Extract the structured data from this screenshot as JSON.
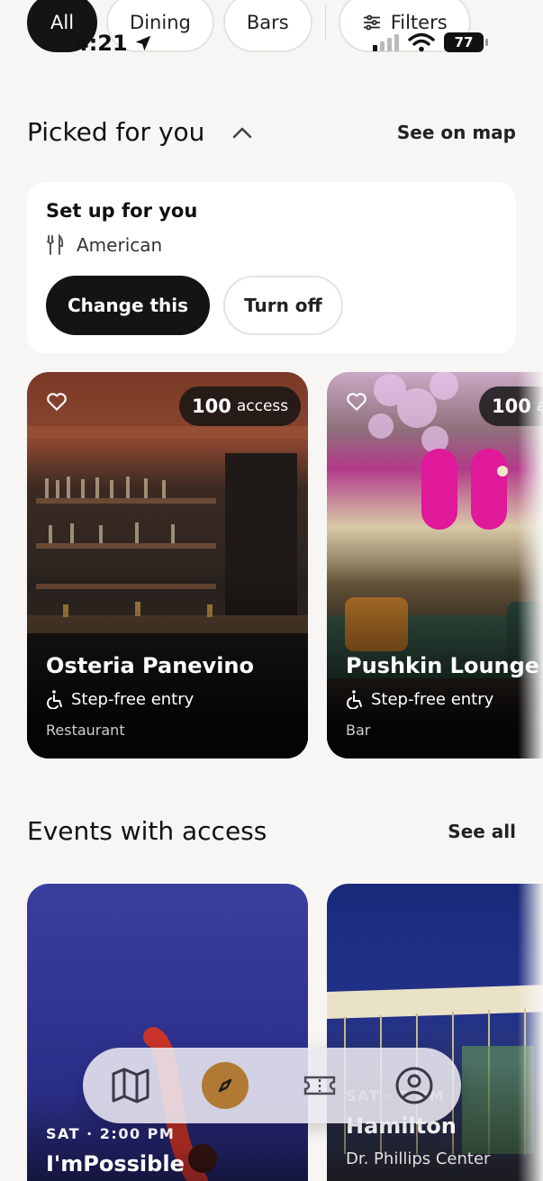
{
  "status_bar": {
    "time": "4:21",
    "battery": "77"
  },
  "filters": [
    {
      "label": "All",
      "active": true
    },
    {
      "label": "Dining",
      "active": false
    },
    {
      "label": "Bars",
      "active": false
    }
  ],
  "filters_button": {
    "label": "Filters",
    "icon": "sliders-icon"
  },
  "picked_section": {
    "title": "Picked for you",
    "link": "See on map"
  },
  "setup_card": {
    "title": "Set up for you",
    "preference": "American",
    "preference_icon": "fork-knife-icon",
    "primary_button": "Change this",
    "secondary_button": "Turn off"
  },
  "venues": [
    {
      "name": "Osteria Panevino",
      "feature": "Step-free entry",
      "type": "Restaurant",
      "access_count": "100",
      "access_label": "access"
    },
    {
      "name": "Pushkin Lounge & ",
      "feature": "Step-free entry",
      "type": "Bar",
      "access_count": "100",
      "access_label": "ac"
    }
  ],
  "events_section": {
    "title": "Events with access",
    "link": "See all"
  },
  "events": [
    {
      "date": "SAT · 2:00 PM",
      "title": "I'mPossible",
      "venue": ""
    },
    {
      "date": "SAT · 2 PM",
      "title": "Hamilton",
      "venue": "Dr. Phillips Center"
    }
  ],
  "tabbar": {
    "items": [
      "map-icon",
      "compass-icon",
      "ticket-icon",
      "profile-icon"
    ],
    "active_index": 1,
    "active_color": "#b07a35"
  }
}
